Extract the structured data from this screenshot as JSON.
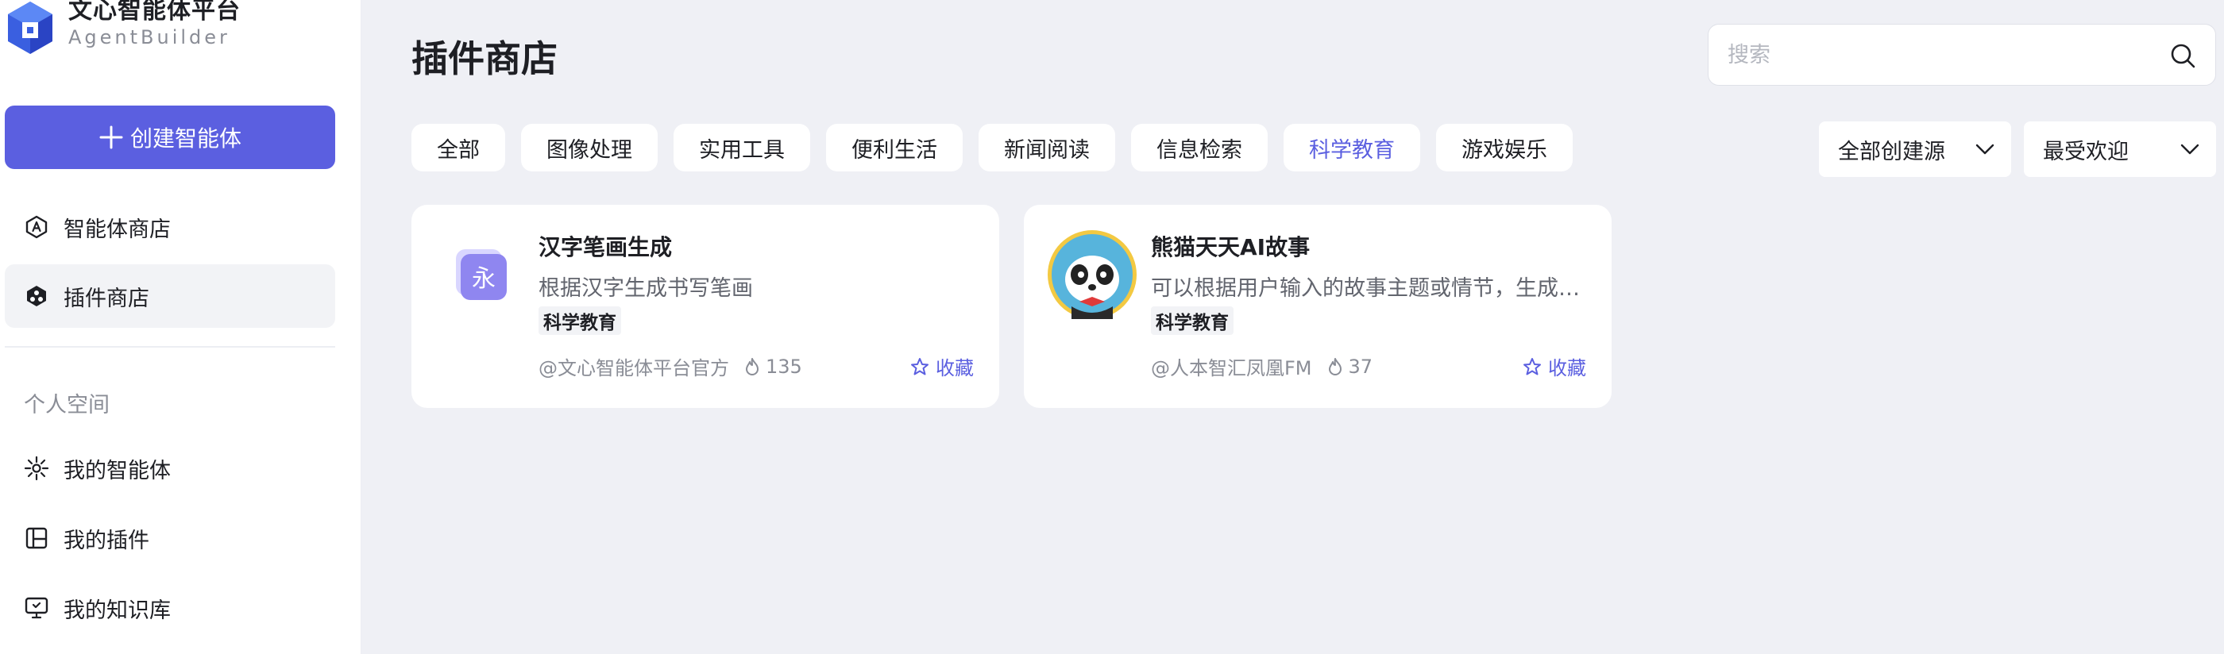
{
  "brand": {
    "name": "文心智能体平台",
    "sub": "AgentBuilder"
  },
  "sidebar": {
    "create_label": "创建智能体",
    "items": [
      {
        "label": "智能体商店",
        "icon": "agent-store-icon"
      },
      {
        "label": "插件商店",
        "icon": "plugin-store-icon",
        "active": true
      }
    ],
    "section_label": "个人空间",
    "personal_items": [
      {
        "label": "我的智能体",
        "icon": "sparkle-icon"
      },
      {
        "label": "我的插件",
        "icon": "layout-icon"
      },
      {
        "label": "我的知识库",
        "icon": "monitor-icon"
      }
    ]
  },
  "main": {
    "title": "插件商店",
    "search": {
      "placeholder": "搜索"
    },
    "tabs": [
      {
        "label": "全部"
      },
      {
        "label": "图像处理"
      },
      {
        "label": "实用工具"
      },
      {
        "label": "便利生活"
      },
      {
        "label": "新闻阅读"
      },
      {
        "label": "信息检索"
      },
      {
        "label": "科学教育",
        "active": true
      },
      {
        "label": "游戏娱乐"
      }
    ],
    "filters": {
      "source": "全部创建源",
      "sort": "最受欢迎"
    },
    "cards": [
      {
        "title": "汉字笔画生成",
        "desc": "根据汉字生成书写笔画",
        "tag": "科学教育",
        "author": "@文心智能体平台官方",
        "count": "135",
        "fav_label": "收藏",
        "avatar_char": "永"
      },
      {
        "title": "熊猫天天AI故事",
        "desc": "可以根据用户输入的故事主题或情节，生成完整的故事",
        "tag": "科学教育",
        "author": "@人本智汇凤凰FM",
        "count": "37",
        "fav_label": "收藏"
      }
    ]
  },
  "colors": {
    "accent": "#5b5fe0",
    "background": "#eff0f5",
    "card": "#ffffff"
  }
}
